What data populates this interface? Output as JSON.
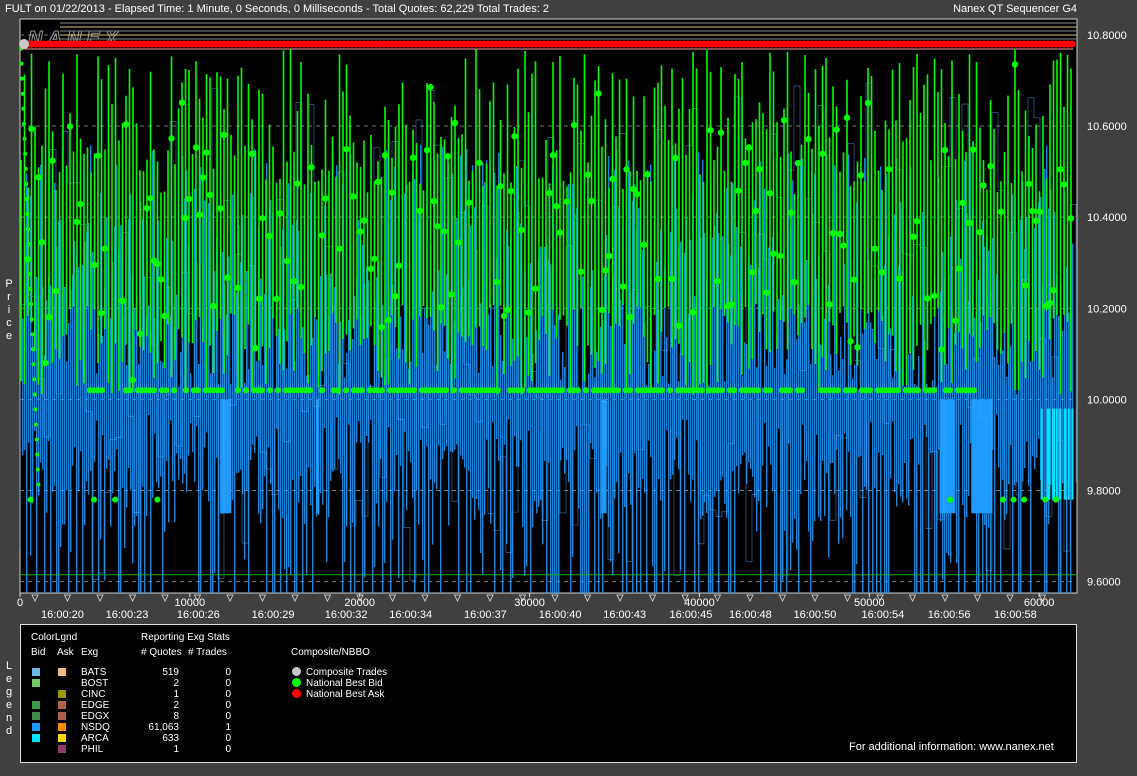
{
  "header": {
    "title": "FULT on 01/22/2013  -  Elapsed Time: 1 Minute, 0 Seconds, 0 Milliseconds  -  Total Quotes: 62,229  Total Trades: 2",
    "app_name": "Nanex QT Sequencer G4"
  },
  "watermark": "NANEX",
  "y_axis_label": "Price",
  "legend_vertical_label": "Legend",
  "chart_data": {
    "type": "line",
    "x_range": [
      0,
      62229
    ],
    "y_range": [
      9.575,
      10.835
    ],
    "y_ticks": [
      "10.8000",
      "10.6000",
      "10.4000",
      "10.2000",
      "10.0000",
      "9.8000",
      "9.6000"
    ],
    "y_tick_values": [
      10.8,
      10.6,
      10.4,
      10.2,
      10.0,
      9.8,
      9.6
    ],
    "x_index_ticks": [
      "0",
      "10000",
      "20000",
      "30000",
      "40000",
      "50000",
      "60000"
    ],
    "x_index_values": [
      0,
      10000,
      20000,
      30000,
      40000,
      50000,
      60000
    ],
    "x_time_ticks": [
      {
        "label": "16:00:20",
        "x": 2500
      },
      {
        "label": "16:00:23",
        "x": 6300
      },
      {
        "label": "16:00:26",
        "x": 10500
      },
      {
        "label": "16:00:29",
        "x": 14900
      },
      {
        "label": "16:00:32",
        "x": 19200
      },
      {
        "label": "16:00:34",
        "x": 23000
      },
      {
        "label": "16:00:37",
        "x": 27400
      },
      {
        "label": "16:00:40",
        "x": 31800
      },
      {
        "label": "16:00:43",
        "x": 35600
      },
      {
        "label": "16:00:45",
        "x": 39500
      },
      {
        "label": "16:00:48",
        "x": 43000
      },
      {
        "label": "16:00:50",
        "x": 46800
      },
      {
        "label": "16:00:54",
        "x": 50800
      },
      {
        "label": "16:00:56",
        "x": 54700
      },
      {
        "label": "16:00:58",
        "x": 58600
      }
    ],
    "grid": true,
    "series": [
      {
        "name": "National Best Ask",
        "color": "#ff0000",
        "value": 10.78
      },
      {
        "name": "National Best Bid",
        "color": "#00ff00",
        "range": [
          9.78,
          10.77
        ]
      },
      {
        "name": "NSDQ",
        "color": "#1e9bff",
        "range": [
          9.6,
          10.6
        ]
      }
    ]
  },
  "legend": {
    "color_title": "ColorLgnd",
    "col_bid": "Bid",
    "col_ask": "Ask",
    "col_exg": "Exg",
    "stats_title": "Reporting Exg Stats",
    "col_quotes": "# Quotes",
    "col_trades": "# Trades",
    "rows": [
      {
        "exg": "BATS",
        "bid_color": "#6fb7e8",
        "ask_color": "#f5b878",
        "quotes": "519",
        "trades": "0"
      },
      {
        "exg": "BOST",
        "bid_color": "#77c86b",
        "ask_color": "#000000",
        "quotes": "2",
        "trades": "0"
      },
      {
        "exg": "CINC",
        "bid_color": "#000000",
        "ask_color": "#9a9a00",
        "quotes": "1",
        "trades": "0"
      },
      {
        "exg": "EDGE",
        "bid_color": "#3f9a4a",
        "ask_color": "#b36048",
        "quotes": "2",
        "trades": "0"
      },
      {
        "exg": "EDGX",
        "bid_color": "#3f8a4a",
        "ask_color": "#b36048",
        "quotes": "8",
        "trades": "0"
      },
      {
        "exg": "NSDQ",
        "bid_color": "#1e9bff",
        "ask_color": "#ff8c00",
        "quotes": "61,063",
        "trades": "1"
      },
      {
        "exg": "ARCA",
        "bid_color": "#00e5ff",
        "ask_color": "#ffd700",
        "quotes": "633",
        "trades": "0"
      },
      {
        "exg": "PHIL",
        "bid_color": "#000000",
        "ask_color": "#8b3a6b",
        "quotes": "1",
        "trades": "0"
      }
    ],
    "composite_title": "Composite/NBBO",
    "composite_items": [
      {
        "label": "Composite Trades",
        "color": "#c8c8c8"
      },
      {
        "label": "National Best Bid",
        "color": "#00ff00"
      },
      {
        "label": "National Best Ask",
        "color": "#ff0000"
      }
    ],
    "footer": "For additional information: www.nanex.net"
  }
}
